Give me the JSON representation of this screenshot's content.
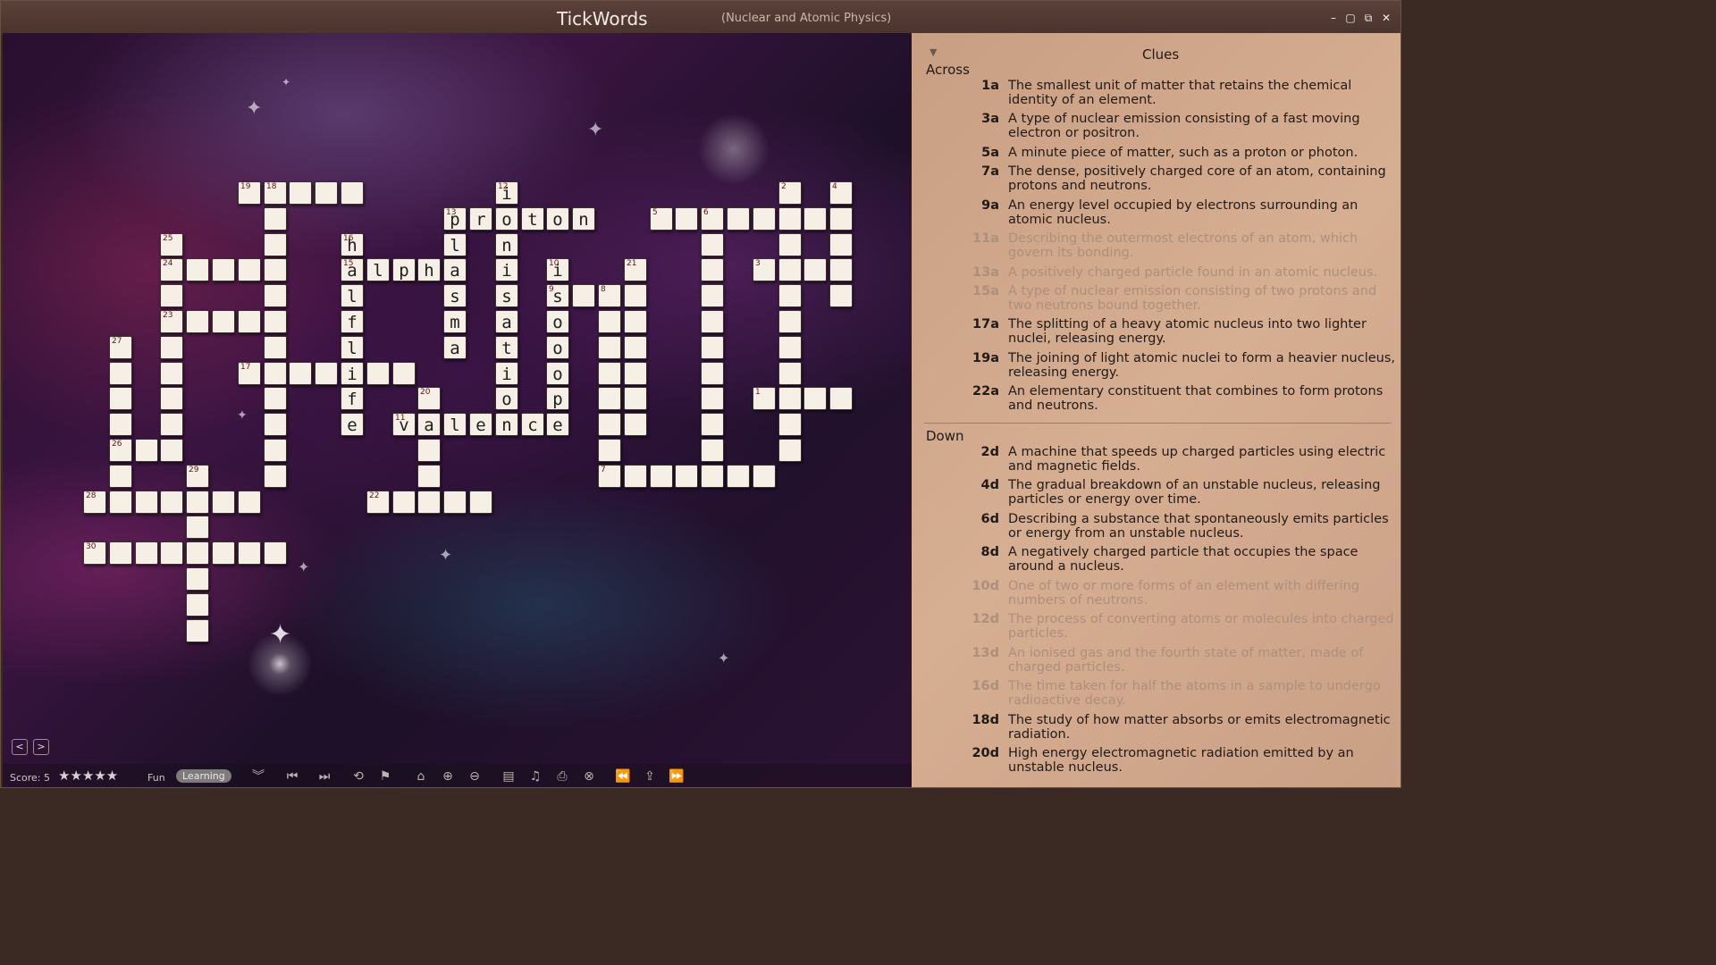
{
  "titlebar": {
    "title": "TickWords",
    "subtitle": "(Nuclear and Atomic Physics)",
    "buttons": [
      "–",
      "▢",
      "⧉",
      "✕"
    ]
  },
  "board": {
    "nav": {
      "prev": "<",
      "next": ">"
    },
    "cells": [
      {
        "r": 0,
        "c": 6,
        "n": "19",
        "l": ""
      },
      {
        "r": 0,
        "c": 7,
        "n": "18",
        "l": ""
      },
      {
        "r": 0,
        "c": 8,
        "n": "",
        "l": ""
      },
      {
        "r": 0,
        "c": 9,
        "n": "",
        "l": ""
      },
      {
        "r": 0,
        "c": 10,
        "n": "",
        "l": ""
      },
      {
        "r": 0,
        "c": 16,
        "n": "12",
        "l": "i"
      },
      {
        "r": 0,
        "c": 27,
        "n": "2",
        "l": ""
      },
      {
        "r": 0,
        "c": 29,
        "n": "4",
        "l": ""
      },
      {
        "r": 1,
        "c": 7,
        "n": "",
        "l": ""
      },
      {
        "r": 1,
        "c": 14,
        "n": "13",
        "l": "p"
      },
      {
        "r": 1,
        "c": 15,
        "n": "",
        "l": "r"
      },
      {
        "r": 1,
        "c": 16,
        "n": "",
        "l": "o"
      },
      {
        "r": 1,
        "c": 17,
        "n": "",
        "l": "t"
      },
      {
        "r": 1,
        "c": 18,
        "n": "",
        "l": "o"
      },
      {
        "r": 1,
        "c": 19,
        "n": "",
        "l": "n"
      },
      {
        "r": 1,
        "c": 22,
        "n": "5",
        "l": ""
      },
      {
        "r": 1,
        "c": 23,
        "n": "",
        "l": ""
      },
      {
        "r": 1,
        "c": 24,
        "n": "6",
        "l": ""
      },
      {
        "r": 1,
        "c": 25,
        "n": "",
        "l": ""
      },
      {
        "r": 1,
        "c": 26,
        "n": "",
        "l": ""
      },
      {
        "r": 1,
        "c": 27,
        "n": "",
        "l": ""
      },
      {
        "r": 1,
        "c": 28,
        "n": "",
        "l": ""
      },
      {
        "r": 1,
        "c": 29,
        "n": "",
        "l": ""
      },
      {
        "r": 2,
        "c": 3,
        "n": "25",
        "l": ""
      },
      {
        "r": 2,
        "c": 7,
        "n": "",
        "l": ""
      },
      {
        "r": 2,
        "c": 10,
        "n": "16",
        "l": "h"
      },
      {
        "r": 2,
        "c": 14,
        "n": "",
        "l": "l"
      },
      {
        "r": 2,
        "c": 16,
        "n": "",
        "l": "n"
      },
      {
        "r": 2,
        "c": 24,
        "n": "",
        "l": ""
      },
      {
        "r": 2,
        "c": 27,
        "n": "",
        "l": ""
      },
      {
        "r": 2,
        "c": 29,
        "n": "",
        "l": ""
      },
      {
        "r": 3,
        "c": 3,
        "n": "24",
        "l": ""
      },
      {
        "r": 3,
        "c": 4,
        "n": "",
        "l": ""
      },
      {
        "r": 3,
        "c": 5,
        "n": "",
        "l": ""
      },
      {
        "r": 3,
        "c": 6,
        "n": "",
        "l": ""
      },
      {
        "r": 3,
        "c": 7,
        "n": "",
        "l": ""
      },
      {
        "r": 3,
        "c": 10,
        "n": "15",
        "l": "a"
      },
      {
        "r": 3,
        "c": 11,
        "n": "",
        "l": "l"
      },
      {
        "r": 3,
        "c": 12,
        "n": "",
        "l": "p"
      },
      {
        "r": 3,
        "c": 13,
        "n": "",
        "l": "h"
      },
      {
        "r": 3,
        "c": 14,
        "n": "",
        "l": "a"
      },
      {
        "r": 3,
        "c": 16,
        "n": "",
        "l": "i"
      },
      {
        "r": 3,
        "c": 18,
        "n": "10",
        "l": "i"
      },
      {
        "r": 3,
        "c": 21,
        "n": "21",
        "l": ""
      },
      {
        "r": 3,
        "c": 24,
        "n": "",
        "l": ""
      },
      {
        "r": 3,
        "c": 26,
        "n": "3",
        "l": ""
      },
      {
        "r": 3,
        "c": 27,
        "n": "",
        "l": ""
      },
      {
        "r": 3,
        "c": 28,
        "n": "",
        "l": ""
      },
      {
        "r": 3,
        "c": 29,
        "n": "",
        "l": ""
      },
      {
        "r": 4,
        "c": 3,
        "n": "",
        "l": ""
      },
      {
        "r": 4,
        "c": 7,
        "n": "",
        "l": ""
      },
      {
        "r": 4,
        "c": 10,
        "n": "",
        "l": "l"
      },
      {
        "r": 4,
        "c": 14,
        "n": "",
        "l": "s"
      },
      {
        "r": 4,
        "c": 16,
        "n": "",
        "l": "s"
      },
      {
        "r": 4,
        "c": 18,
        "n": "9",
        "l": "s"
      },
      {
        "r": 4,
        "c": 19,
        "n": "",
        "l": ""
      },
      {
        "r": 4,
        "c": 20,
        "n": "8",
        "l": ""
      },
      {
        "r": 4,
        "c": 21,
        "n": "",
        "l": ""
      },
      {
        "r": 4,
        "c": 24,
        "n": "",
        "l": ""
      },
      {
        "r": 4,
        "c": 27,
        "n": "",
        "l": ""
      },
      {
        "r": 4,
        "c": 29,
        "n": "",
        "l": ""
      },
      {
        "r": 5,
        "c": 3,
        "n": "23",
        "l": ""
      },
      {
        "r": 5,
        "c": 4,
        "n": "",
        "l": ""
      },
      {
        "r": 5,
        "c": 5,
        "n": "",
        "l": ""
      },
      {
        "r": 5,
        "c": 6,
        "n": "",
        "l": ""
      },
      {
        "r": 5,
        "c": 7,
        "n": "",
        "l": ""
      },
      {
        "r": 5,
        "c": 10,
        "n": "",
        "l": "f"
      },
      {
        "r": 5,
        "c": 14,
        "n": "",
        "l": "m"
      },
      {
        "r": 5,
        "c": 16,
        "n": "",
        "l": "a"
      },
      {
        "r": 5,
        "c": 18,
        "n": "",
        "l": "o"
      },
      {
        "r": 5,
        "c": 20,
        "n": "",
        "l": ""
      },
      {
        "r": 5,
        "c": 21,
        "n": "",
        "l": ""
      },
      {
        "r": 5,
        "c": 24,
        "n": "",
        "l": ""
      },
      {
        "r": 5,
        "c": 27,
        "n": "",
        "l": ""
      },
      {
        "r": 6,
        "c": 1,
        "n": "27",
        "l": ""
      },
      {
        "r": 6,
        "c": 3,
        "n": "",
        "l": ""
      },
      {
        "r": 6,
        "c": 7,
        "n": "",
        "l": ""
      },
      {
        "r": 6,
        "c": 10,
        "n": "",
        "l": "l"
      },
      {
        "r": 6,
        "c": 14,
        "n": "",
        "l": "a"
      },
      {
        "r": 6,
        "c": 16,
        "n": "",
        "l": "t"
      },
      {
        "r": 6,
        "c": 18,
        "n": "",
        "l": "o"
      },
      {
        "r": 6,
        "c": 20,
        "n": "",
        "l": ""
      },
      {
        "r": 6,
        "c": 21,
        "n": "",
        "l": ""
      },
      {
        "r": 6,
        "c": 24,
        "n": "",
        "l": ""
      },
      {
        "r": 6,
        "c": 27,
        "n": "",
        "l": ""
      },
      {
        "r": 7,
        "c": 1,
        "n": "",
        "l": ""
      },
      {
        "r": 7,
        "c": 3,
        "n": "",
        "l": ""
      },
      {
        "r": 7,
        "c": 6,
        "n": "17",
        "l": ""
      },
      {
        "r": 7,
        "c": 7,
        "n": "",
        "l": ""
      },
      {
        "r": 7,
        "c": 8,
        "n": "",
        "l": ""
      },
      {
        "r": 7,
        "c": 9,
        "n": "",
        "l": ""
      },
      {
        "r": 7,
        "c": 10,
        "n": "",
        "l": "i"
      },
      {
        "r": 7,
        "c": 11,
        "n": "",
        "l": ""
      },
      {
        "r": 7,
        "c": 12,
        "n": "",
        "l": ""
      },
      {
        "r": 7,
        "c": 16,
        "n": "",
        "l": "i"
      },
      {
        "r": 7,
        "c": 18,
        "n": "",
        "l": "o"
      },
      {
        "r": 7,
        "c": 20,
        "n": "",
        "l": ""
      },
      {
        "r": 7,
        "c": 21,
        "n": "",
        "l": ""
      },
      {
        "r": 7,
        "c": 24,
        "n": "",
        "l": ""
      },
      {
        "r": 7,
        "c": 27,
        "n": "",
        "l": ""
      },
      {
        "r": 8,
        "c": 1,
        "n": "",
        "l": ""
      },
      {
        "r": 8,
        "c": 3,
        "n": "",
        "l": ""
      },
      {
        "r": 8,
        "c": 7,
        "n": "",
        "l": ""
      },
      {
        "r": 8,
        "c": 10,
        "n": "",
        "l": "f"
      },
      {
        "r": 8,
        "c": 13,
        "n": "20",
        "l": ""
      },
      {
        "r": 8,
        "c": 16,
        "n": "",
        "l": "o"
      },
      {
        "r": 8,
        "c": 18,
        "n": "",
        "l": "p"
      },
      {
        "r": 8,
        "c": 20,
        "n": "",
        "l": ""
      },
      {
        "r": 8,
        "c": 21,
        "n": "",
        "l": ""
      },
      {
        "r": 8,
        "c": 24,
        "n": "",
        "l": ""
      },
      {
        "r": 8,
        "c": 26,
        "n": "1",
        "l": ""
      },
      {
        "r": 8,
        "c": 27,
        "n": "",
        "l": ""
      },
      {
        "r": 8,
        "c": 28,
        "n": "",
        "l": ""
      },
      {
        "r": 8,
        "c": 29,
        "n": "",
        "l": ""
      },
      {
        "r": 9,
        "c": 1,
        "n": "",
        "l": ""
      },
      {
        "r": 9,
        "c": 3,
        "n": "",
        "l": ""
      },
      {
        "r": 9,
        "c": 7,
        "n": "",
        "l": ""
      },
      {
        "r": 9,
        "c": 10,
        "n": "",
        "l": "e"
      },
      {
        "r": 9,
        "c": 12,
        "n": "11",
        "l": "v"
      },
      {
        "r": 9,
        "c": 13,
        "n": "",
        "l": "a"
      },
      {
        "r": 9,
        "c": 14,
        "n": "",
        "l": "l"
      },
      {
        "r": 9,
        "c": 15,
        "n": "",
        "l": "e"
      },
      {
        "r": 9,
        "c": 16,
        "n": "",
        "l": "n"
      },
      {
        "r": 9,
        "c": 17,
        "n": "",
        "l": "c"
      },
      {
        "r": 9,
        "c": 18,
        "n": "",
        "l": "e"
      },
      {
        "r": 9,
        "c": 20,
        "n": "",
        "l": ""
      },
      {
        "r": 9,
        "c": 21,
        "n": "",
        "l": ""
      },
      {
        "r": 9,
        "c": 24,
        "n": "",
        "l": ""
      },
      {
        "r": 9,
        "c": 27,
        "n": "",
        "l": ""
      },
      {
        "r": 10,
        "c": 1,
        "n": "26",
        "l": ""
      },
      {
        "r": 10,
        "c": 2,
        "n": "",
        "l": ""
      },
      {
        "r": 10,
        "c": 3,
        "n": "",
        "l": ""
      },
      {
        "r": 10,
        "c": 7,
        "n": "",
        "l": ""
      },
      {
        "r": 10,
        "c": 13,
        "n": "",
        "l": ""
      },
      {
        "r": 10,
        "c": 20,
        "n": "",
        "l": ""
      },
      {
        "r": 10,
        "c": 24,
        "n": "",
        "l": ""
      },
      {
        "r": 10,
        "c": 27,
        "n": "",
        "l": ""
      },
      {
        "r": 11,
        "c": 1,
        "n": "",
        "l": ""
      },
      {
        "r": 11,
        "c": 4,
        "n": "29",
        "l": ""
      },
      {
        "r": 11,
        "c": 7,
        "n": "",
        "l": ""
      },
      {
        "r": 11,
        "c": 13,
        "n": "",
        "l": ""
      },
      {
        "r": 11,
        "c": 20,
        "n": "7",
        "l": ""
      },
      {
        "r": 11,
        "c": 21,
        "n": "",
        "l": ""
      },
      {
        "r": 11,
        "c": 22,
        "n": "",
        "l": ""
      },
      {
        "r": 11,
        "c": 23,
        "n": "",
        "l": ""
      },
      {
        "r": 11,
        "c": 24,
        "n": "",
        "l": ""
      },
      {
        "r": 11,
        "c": 25,
        "n": "",
        "l": ""
      },
      {
        "r": 11,
        "c": 26,
        "n": "",
        "l": ""
      },
      {
        "r": 12,
        "c": 0,
        "n": "28",
        "l": ""
      },
      {
        "r": 12,
        "c": 1,
        "n": "",
        "l": ""
      },
      {
        "r": 12,
        "c": 2,
        "n": "",
        "l": ""
      },
      {
        "r": 12,
        "c": 3,
        "n": "",
        "l": ""
      },
      {
        "r": 12,
        "c": 4,
        "n": "",
        "l": ""
      },
      {
        "r": 12,
        "c": 5,
        "n": "",
        "l": ""
      },
      {
        "r": 12,
        "c": 6,
        "n": "",
        "l": ""
      },
      {
        "r": 12,
        "c": 11,
        "n": "22",
        "l": ""
      },
      {
        "r": 12,
        "c": 12,
        "n": "",
        "l": ""
      },
      {
        "r": 12,
        "c": 13,
        "n": "",
        "l": ""
      },
      {
        "r": 12,
        "c": 14,
        "n": "",
        "l": ""
      },
      {
        "r": 12,
        "c": 15,
        "n": "",
        "l": ""
      },
      {
        "r": 13,
        "c": 4,
        "n": "",
        "l": ""
      },
      {
        "r": 14,
        "c": 0,
        "n": "30",
        "l": ""
      },
      {
        "r": 14,
        "c": 1,
        "n": "",
        "l": ""
      },
      {
        "r": 14,
        "c": 2,
        "n": "",
        "l": ""
      },
      {
        "r": 14,
        "c": 3,
        "n": "",
        "l": ""
      },
      {
        "r": 14,
        "c": 4,
        "n": "",
        "l": ""
      },
      {
        "r": 14,
        "c": 5,
        "n": "",
        "l": ""
      },
      {
        "r": 14,
        "c": 6,
        "n": "",
        "l": ""
      },
      {
        "r": 14,
        "c": 7,
        "n": "",
        "l": ""
      },
      {
        "r": 15,
        "c": 4,
        "n": "",
        "l": ""
      },
      {
        "r": 16,
        "c": 4,
        "n": "",
        "l": ""
      },
      {
        "r": 17,
        "c": 4,
        "n": "",
        "l": ""
      }
    ]
  },
  "bottombar": {
    "score_label": "Score: 5",
    "stars": "★★★★★",
    "rating": 5,
    "fun_label": "Fun",
    "learning_label": "Learning",
    "tools": [
      {
        "name": "collapse-icon",
        "glyph": "︾"
      },
      {
        "name": "first-clue-icon",
        "glyph": "⏮"
      },
      {
        "name": "last-clue-icon",
        "glyph": "⏭"
      },
      {
        "name": "reset-icon",
        "glyph": "⟲"
      },
      {
        "name": "flag-icon",
        "glyph": "⚑"
      },
      {
        "name": "home-icon",
        "glyph": "⌂"
      },
      {
        "name": "zoom-in-icon",
        "glyph": "⊕"
      },
      {
        "name": "zoom-out-icon",
        "glyph": "⊖"
      },
      {
        "name": "layout-icon",
        "glyph": "▤"
      },
      {
        "name": "music-icon",
        "glyph": "♫"
      },
      {
        "name": "print-icon",
        "glyph": "⎙"
      },
      {
        "name": "close-circle-icon",
        "glyph": "⊗"
      },
      {
        "name": "rewind-icon",
        "glyph": "⏪"
      },
      {
        "name": "share-icon",
        "glyph": "⇪"
      },
      {
        "name": "fast-forward-icon",
        "glyph": "⏩"
      }
    ]
  },
  "clues": {
    "title": "Clues",
    "collapse_arrow": "▼",
    "across_heading": "Across",
    "down_heading": "Down",
    "across": [
      {
        "n": "1a",
        "text": "The smallest unit of matter that retains the chemical identity of an element.",
        "dim": false
      },
      {
        "n": "3a",
        "text": "A type of nuclear emission consisting of a fast moving electron or positron.",
        "dim": false
      },
      {
        "n": "5a",
        "text": "A minute piece of matter, such as a proton or photon.",
        "dim": false
      },
      {
        "n": "7a",
        "text": "The dense, positively charged core of an atom, containing protons and neutrons.",
        "dim": false
      },
      {
        "n": "9a",
        "text": "An energy level occupied by electrons surrounding an atomic nucleus.",
        "dim": false
      },
      {
        "n": "11a",
        "text": "Describing the outermost electrons of an atom, which govern its bonding.",
        "dim": true
      },
      {
        "n": "13a",
        "text": "A positively charged particle found in an atomic nucleus.",
        "dim": true
      },
      {
        "n": "15a",
        "text": "A type of nuclear emission consisting of two protons and two neutrons bound together.",
        "dim": true
      },
      {
        "n": "17a",
        "text": "The splitting of a heavy atomic nucleus into two lighter nuclei, releasing energy.",
        "dim": false
      },
      {
        "n": "19a",
        "text": "The joining of light atomic nuclei to form a heavier nucleus, releasing energy.",
        "dim": false
      },
      {
        "n": "22a",
        "text": "An elementary constituent that combines to form protons and neutrons.",
        "dim": false
      }
    ],
    "down": [
      {
        "n": "2d",
        "text": "A machine that speeds up charged particles using electric and magnetic fields.",
        "dim": false
      },
      {
        "n": "4d",
        "text": "The gradual breakdown of an unstable nucleus, releasing particles or energy over time.",
        "dim": false
      },
      {
        "n": "6d",
        "text": "Describing a substance that spontaneously emits particles or energy from an unstable nucleus.",
        "dim": false
      },
      {
        "n": "8d",
        "text": "A negatively charged particle that occupies the space around a nucleus.",
        "dim": false
      },
      {
        "n": "10d",
        "text": "One of two or more forms of an element with differing numbers of neutrons.",
        "dim": true
      },
      {
        "n": "12d",
        "text": "The process of converting atoms or molecules into charged particles.",
        "dim": true
      },
      {
        "n": "13d",
        "text": "An ionised gas and the fourth state of matter, made of charged particles.",
        "dim": true
      },
      {
        "n": "16d",
        "text": "The time taken for half the atoms in a sample to undergo radioactive decay.",
        "dim": true
      },
      {
        "n": "18d",
        "text": "The study of how matter absorbs or emits electromagnetic radiation.",
        "dim": false
      },
      {
        "n": "20d",
        "text": "High energy electromagnetic radiation emitted by an unstable nucleus.",
        "dim": false
      }
    ]
  }
}
